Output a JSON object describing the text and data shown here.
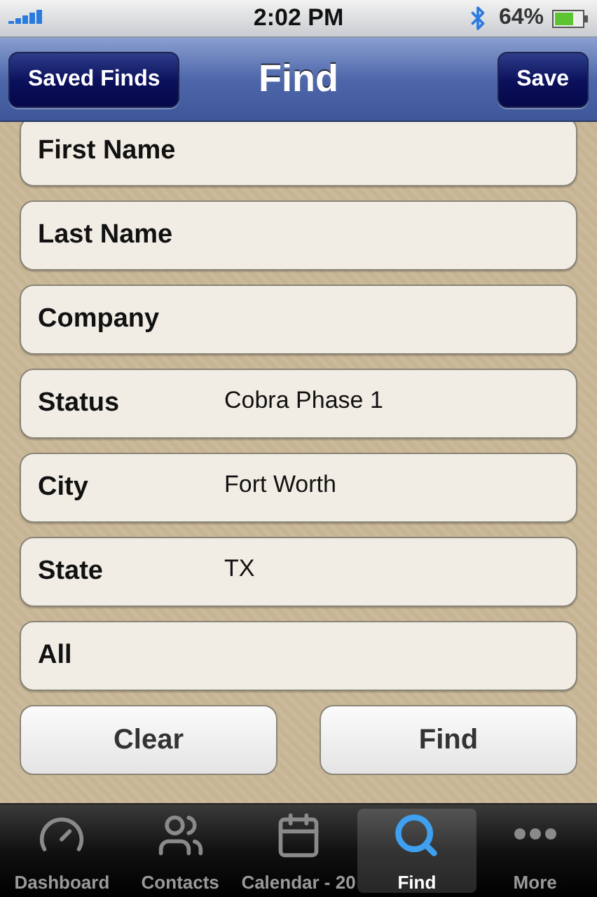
{
  "status_bar": {
    "time": "2:02 PM",
    "battery": "64%"
  },
  "nav_bar": {
    "left_button": "Saved Finds",
    "title": "Find",
    "right_button": "Save"
  },
  "fields": [
    {
      "label": "First Name"
    },
    {
      "label": "Last Name"
    },
    {
      "label": "Company"
    },
    {
      "label": "Status",
      "value": "Cobra Phase 1"
    },
    {
      "label": "City",
      "value": "Fort Worth"
    },
    {
      "label": "State",
      "value": "TX"
    },
    {
      "label": "All"
    }
  ],
  "buttons": [
    "Clear",
    "Find"
  ],
  "tabs": [
    {
      "label": "Dashboard",
      "selected": false
    },
    {
      "label": "Contacts",
      "selected": false
    },
    {
      "label": "Calendar - 20",
      "selected": false
    },
    {
      "label": "Find",
      "selected": true
    },
    {
      "label": "More",
      "selected": false
    }
  ]
}
